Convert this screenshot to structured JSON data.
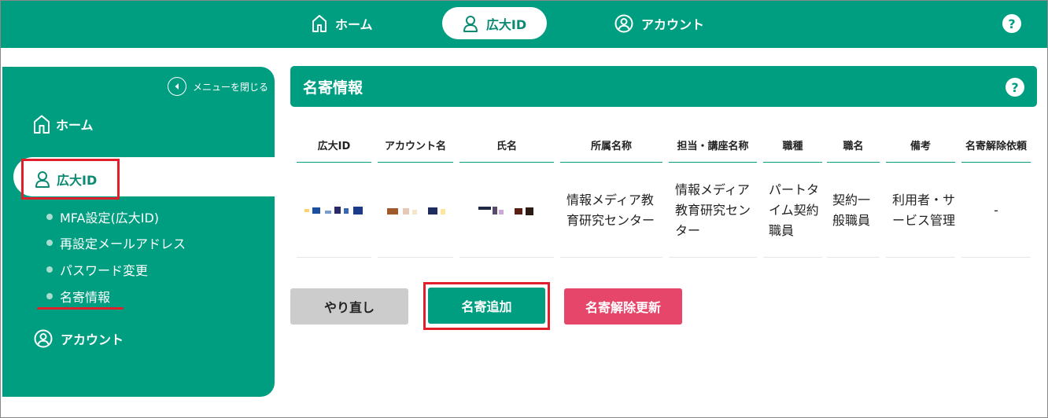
{
  "topnav": {
    "home_label": "ホーム",
    "id_label": "広大ID",
    "account_label": "アカウント",
    "help_label": "?"
  },
  "sidebar": {
    "close_menu_label": "メニューを閉じる",
    "home_label": "ホーム",
    "id_label": "広大ID",
    "sub_items": [
      {
        "label": "MFA設定(広大ID)"
      },
      {
        "label": "再設定メールアドレス"
      },
      {
        "label": "パスワード変更"
      },
      {
        "label": "名寄情報"
      }
    ],
    "account_label": "アカウント"
  },
  "main": {
    "title": "名寄情報",
    "help_label": "?",
    "table": {
      "headers": [
        "広大ID",
        "アカウント名",
        "氏名",
        "所属名称",
        "担当・講座名称",
        "職種",
        "職名",
        "備考",
        "名寄解除依頼"
      ],
      "row": {
        "affiliation": "情報メディア教育研究センター",
        "department": "情報メディア教育研究センター",
        "job_type": "パートタイム契約職員",
        "job_title": "契約一般職員",
        "note": "利用者・サービス管理",
        "release_request": "-"
      }
    },
    "buttons": {
      "redo": "やり直し",
      "add": "名寄追加",
      "update": "名寄解除更新"
    }
  },
  "colors": {
    "primary": "#009e81",
    "highlight_red": "#e01e2c",
    "update_button": "#e6466a",
    "redo_button": "#cccccc"
  }
}
